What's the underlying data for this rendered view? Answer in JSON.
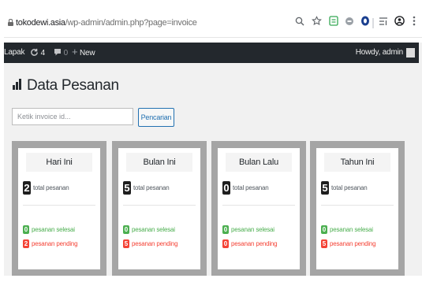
{
  "browser": {
    "url_host": "tokodewi.asia",
    "url_path": "/wp-admin/admin.php?page=invoice",
    "icons": [
      "lock-icon",
      "zoom-icon",
      "star-icon",
      "extension-list-icon",
      "extension-gray-icon",
      "extension-blue-icon",
      "reading-list-icon",
      "profile-icon",
      "menu-icon"
    ]
  },
  "adminbar": {
    "site": "Lapak",
    "updates_count": "4",
    "comments_count": "0",
    "new_label": "New",
    "greeting": "Howdy, admin"
  },
  "page": {
    "title": "Data Pesanan"
  },
  "search": {
    "placeholder": "Ketik invoice id...",
    "button": "Pencarian"
  },
  "colors": {
    "adminbar_bg": "#23282d",
    "card_border": "#a5a5a5",
    "success": "#4caf50",
    "danger": "#f44336",
    "accent": "#2271b1"
  },
  "cards": [
    {
      "title": "Hari Ini",
      "total": "2",
      "total_label": "total pesanan",
      "done": "0",
      "done_label": "pesanan selesai",
      "pending": "2",
      "pending_label": "pesanan pending"
    },
    {
      "title": "Bulan Ini",
      "total": "5",
      "total_label": "total pesanan",
      "done": "0",
      "done_label": "pesanan selesai",
      "pending": "5",
      "pending_label": "pesanan pending"
    },
    {
      "title": "Bulan Lalu",
      "total": "0",
      "total_label": "total pesanan",
      "done": "0",
      "done_label": "pesanan selesai",
      "pending": "0",
      "pending_label": "pesanan pending"
    },
    {
      "title": "Tahun Ini",
      "total": "5",
      "total_label": "total pesanan",
      "done": "0",
      "done_label": "pesanan selesai",
      "pending": "5",
      "pending_label": "pesanan pending"
    }
  ]
}
